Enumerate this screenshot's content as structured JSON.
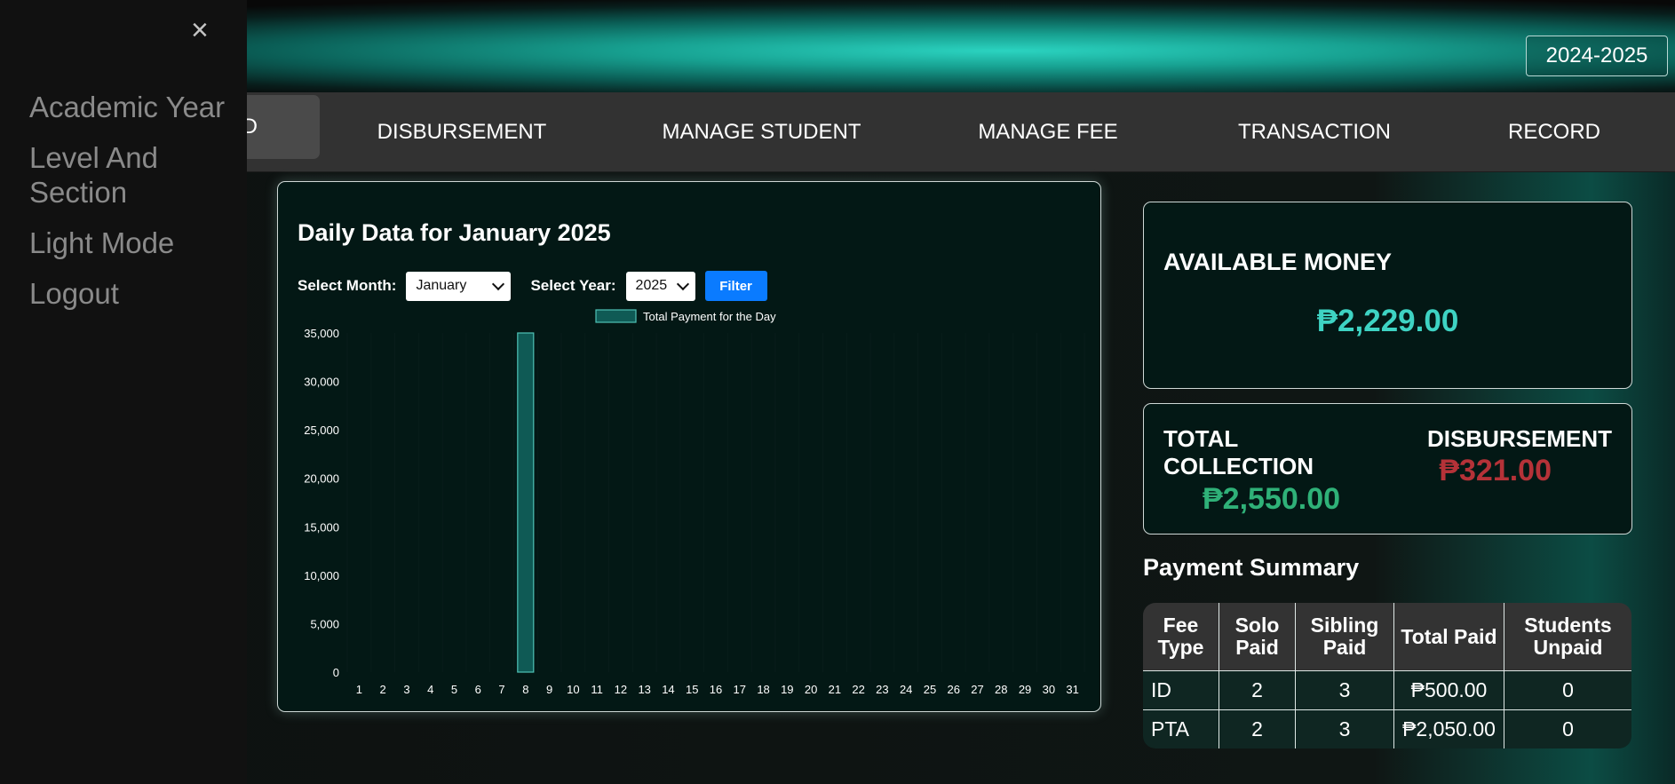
{
  "header": {
    "academic_year": "2024-2025"
  },
  "nav": {
    "active_partial": "D",
    "items": [
      "DISBURSEMENT",
      "MANAGE STUDENT",
      "MANAGE FEE",
      "TRANSACTION",
      "RECORD"
    ]
  },
  "sidebar": {
    "close_icon": "×",
    "items": [
      "Academic Year",
      "Level And Section",
      "Light Mode",
      "Logout"
    ]
  },
  "chart": {
    "title": "Daily Data for January 2025",
    "month_label": "Select Month:",
    "month_value": "January",
    "year_label": "Select Year:",
    "year_value": "2025",
    "filter_label": "Filter"
  },
  "chart_data": {
    "type": "bar",
    "title": "Daily Data for January 2025",
    "categories": [
      "1",
      "2",
      "3",
      "4",
      "5",
      "6",
      "7",
      "8",
      "9",
      "10",
      "11",
      "12",
      "13",
      "14",
      "15",
      "16",
      "17",
      "18",
      "19",
      "20",
      "21",
      "22",
      "23",
      "24",
      "25",
      "26",
      "27",
      "28",
      "29",
      "30",
      "31"
    ],
    "series": [
      {
        "name": "Total Payment for the Day",
        "values": [
          0,
          0,
          0,
          0,
          0,
          0,
          0,
          35000,
          0,
          0,
          0,
          0,
          0,
          0,
          0,
          0,
          0,
          0,
          0,
          0,
          0,
          0,
          0,
          0,
          0,
          0,
          0,
          0,
          0,
          0,
          0
        ]
      }
    ],
    "yticks": [
      "0",
      "5,000",
      "10,000",
      "15,000",
      "20,000",
      "25,000",
      "30,000",
      "35,000"
    ],
    "ylim": [
      0,
      35000
    ],
    "legend_position": "top-center",
    "bar_fill": "#0f5a55",
    "bar_stroke": "#4fc2b6",
    "grid": true
  },
  "money": {
    "title": "AVAILABLE MONEY",
    "value": "₱2,229.00"
  },
  "collection": {
    "title": "TOTAL COLLECTION",
    "value": "₱2,550.00",
    "disb_title": "DISBURSEMENT",
    "disb_value": "₱321.00"
  },
  "summary": {
    "title": "Payment Summary",
    "headers": [
      "Fee Type",
      "Solo Paid",
      "Sibling Paid",
      "Total Paid",
      "Students Unpaid"
    ],
    "rows": [
      [
        "ID",
        "2",
        "3",
        "₱500.00",
        "0"
      ],
      [
        "PTA",
        "2",
        "3",
        "₱2,050.00",
        "0"
      ]
    ]
  },
  "colors": {
    "accent_teal": "#3ed3c3",
    "collection_green": "#2fb178",
    "disbursement_red": "#b53238",
    "filter_blue": "#0a7bff"
  }
}
